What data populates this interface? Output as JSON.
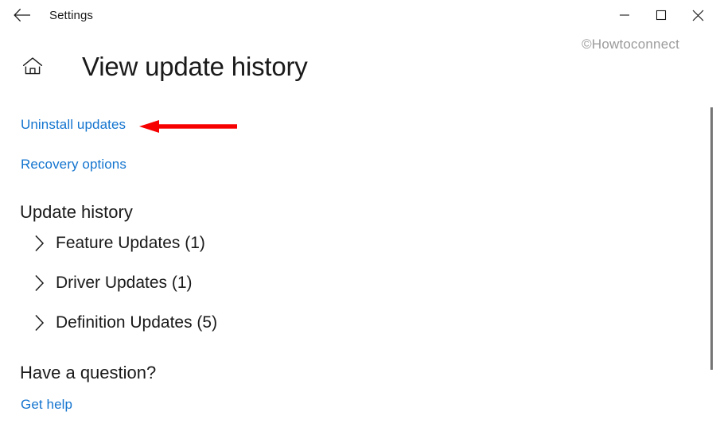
{
  "window": {
    "app_title": "Settings",
    "back_icon": "back-arrow-icon",
    "controls": {
      "minimize": "minimize-icon",
      "maximize": "maximize-icon",
      "close": "close-icon"
    }
  },
  "watermark": {
    "text": "©Howtoconnect"
  },
  "header": {
    "home_icon": "home-icon",
    "title": "View update history"
  },
  "links": {
    "uninstall_updates": "Uninstall updates",
    "recovery_options": "Recovery options",
    "get_help": "Get help"
  },
  "sections": {
    "update_history_heading": "Update history",
    "question_heading": "Have a question?"
  },
  "update_history": {
    "items": [
      {
        "label": "Feature Updates (1)",
        "name": "feature-updates",
        "expanded": false
      },
      {
        "label": "Driver Updates (1)",
        "name": "driver-updates",
        "expanded": false
      },
      {
        "label": "Definition Updates (5)",
        "name": "definition-updates",
        "expanded": false
      }
    ]
  },
  "annotation": {
    "type": "arrow-left",
    "color": "#f70000",
    "points_to": "Uninstall updates"
  },
  "colors": {
    "background": "#ffffff",
    "text": "#1a1a1a",
    "link": "#1374cf",
    "watermark": "#9a9a9a",
    "annotation_red": "#f70000",
    "scrollbar_thumb": "#757575"
  }
}
